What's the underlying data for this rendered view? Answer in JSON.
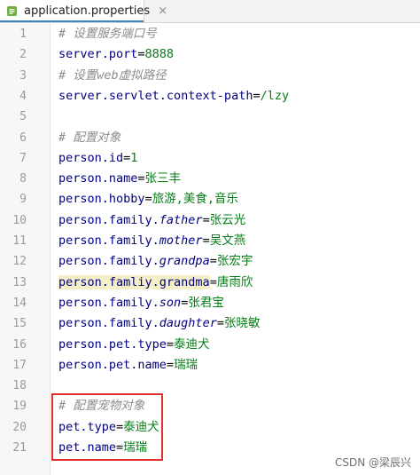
{
  "tab": {
    "title": "application.properties",
    "close_glyph": "×",
    "icon": "properties-file-icon"
  },
  "lines": [
    {
      "n": "1",
      "parts": [
        {
          "t": "# 设置服务端口号",
          "c": "comment"
        }
      ]
    },
    {
      "n": "2",
      "parts": [
        {
          "t": "server.port",
          "c": "key"
        },
        {
          "t": "=",
          "c": "eq"
        },
        {
          "t": "8888",
          "c": "val"
        }
      ]
    },
    {
      "n": "3",
      "parts": [
        {
          "t": "# 设置web虚拟路径",
          "c": "comment"
        }
      ]
    },
    {
      "n": "4",
      "parts": [
        {
          "t": "server.servlet.context-path",
          "c": "key"
        },
        {
          "t": "=",
          "c": "eq"
        },
        {
          "t": "/lzy",
          "c": "val"
        }
      ]
    },
    {
      "n": "5",
      "parts": []
    },
    {
      "n": "6",
      "parts": [
        {
          "t": "# 配置对象",
          "c": "comment"
        }
      ]
    },
    {
      "n": "7",
      "parts": [
        {
          "t": "person.id",
          "c": "key"
        },
        {
          "t": "=",
          "c": "eq"
        },
        {
          "t": "1",
          "c": "val"
        }
      ]
    },
    {
      "n": "8",
      "parts": [
        {
          "t": "person.name",
          "c": "key"
        },
        {
          "t": "=",
          "c": "eq"
        },
        {
          "t": "张三丰",
          "c": "val"
        }
      ]
    },
    {
      "n": "9",
      "parts": [
        {
          "t": "person.hobby",
          "c": "key"
        },
        {
          "t": "=",
          "c": "eq"
        },
        {
          "t": "旅游,美食,音乐",
          "c": "val"
        }
      ]
    },
    {
      "n": "10",
      "parts": [
        {
          "t": "person.family.",
          "c": "key"
        },
        {
          "t": "father",
          "c": "key it"
        },
        {
          "t": "=",
          "c": "eq"
        },
        {
          "t": "张云光",
          "c": "val"
        }
      ]
    },
    {
      "n": "11",
      "parts": [
        {
          "t": "person.family.",
          "c": "key"
        },
        {
          "t": "mother",
          "c": "key it"
        },
        {
          "t": "=",
          "c": "eq"
        },
        {
          "t": "吴文燕",
          "c": "val"
        }
      ]
    },
    {
      "n": "12",
      "parts": [
        {
          "t": "person.family.",
          "c": "key"
        },
        {
          "t": "grandpa",
          "c": "key it"
        },
        {
          "t": "=",
          "c": "eq"
        },
        {
          "t": "张宏宇",
          "c": "val"
        }
      ]
    },
    {
      "n": "13",
      "parts": [
        {
          "t": "person.famliy.grandma",
          "c": "key hl-key"
        },
        {
          "t": "=",
          "c": "eq"
        },
        {
          "t": "唐雨欣",
          "c": "val"
        }
      ]
    },
    {
      "n": "14",
      "parts": [
        {
          "t": "person.family.",
          "c": "key"
        },
        {
          "t": "son",
          "c": "key it"
        },
        {
          "t": "=",
          "c": "eq"
        },
        {
          "t": "张君宝",
          "c": "val"
        }
      ]
    },
    {
      "n": "15",
      "parts": [
        {
          "t": "person.family.",
          "c": "key"
        },
        {
          "t": "daughter",
          "c": "key it"
        },
        {
          "t": "=",
          "c": "eq"
        },
        {
          "t": "张晓敏",
          "c": "val"
        }
      ]
    },
    {
      "n": "16",
      "parts": [
        {
          "t": "person.pet.type",
          "c": "key"
        },
        {
          "t": "=",
          "c": "eq"
        },
        {
          "t": "泰迪犬",
          "c": "val"
        }
      ]
    },
    {
      "n": "17",
      "parts": [
        {
          "t": "person.pet.name",
          "c": "key"
        },
        {
          "t": "=",
          "c": "eq"
        },
        {
          "t": "瑞瑞",
          "c": "val"
        }
      ]
    },
    {
      "n": "18",
      "parts": []
    },
    {
      "n": "19",
      "parts": [
        {
          "t": "# 配置宠物对象",
          "c": "comment"
        }
      ]
    },
    {
      "n": "20",
      "parts": [
        {
          "t": "pet.type",
          "c": "key"
        },
        {
          "t": "=",
          "c": "eq"
        },
        {
          "t": "泰迪犬",
          "c": "val"
        }
      ]
    },
    {
      "n": "21",
      "parts": [
        {
          "t": "pet.name",
          "c": "key"
        },
        {
          "t": "=",
          "c": "eq"
        },
        {
          "t": "瑞瑞",
          "c": "val"
        }
      ]
    }
  ],
  "annotation": {
    "color": "#e0302d",
    "first_line": 19,
    "last_line": 21
  },
  "watermark": "CSDN @梁辰兴",
  "colors": {
    "key": "#000080",
    "value": "#067d17",
    "comment": "#8c8c8c",
    "tab_accent": "#4083c9"
  }
}
